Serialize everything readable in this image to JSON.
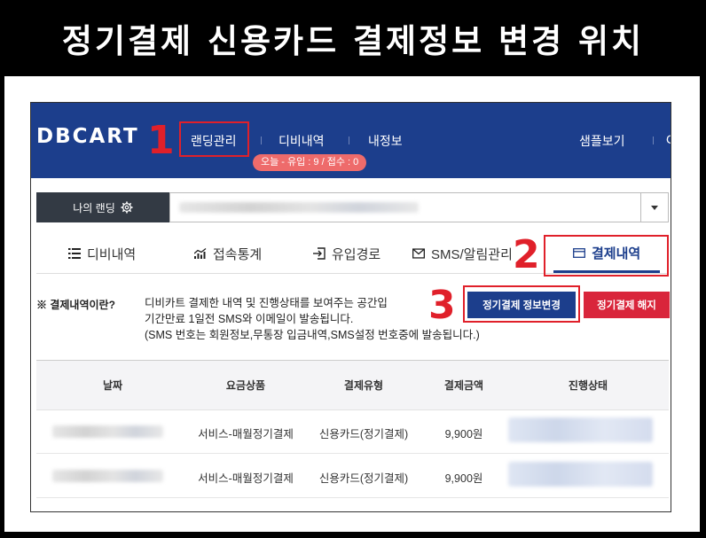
{
  "banner": {
    "title": "정기결제 신용카드 결제정보 변경 위치"
  },
  "navbar": {
    "logo": "DBCART",
    "items": [
      "랜딩관리",
      "디비내역",
      "내정보"
    ],
    "right_items": [
      "샘플보기",
      "C"
    ],
    "badge": "오늘 - 유입 : 9 / 접수 : 0"
  },
  "landing": {
    "label": "나의 랜딩",
    "settings_icon": "gear-icon",
    "selected_value": ""
  },
  "tabs": [
    {
      "label": "디비내역",
      "icon": "list-icon"
    },
    {
      "label": "접속통계",
      "icon": "chart-icon"
    },
    {
      "label": "유입경로",
      "icon": "signin-icon"
    },
    {
      "label": "SMS/알림관리",
      "icon": "mail-icon"
    },
    {
      "label": "결제내역",
      "icon": "card-icon",
      "active": true
    }
  ],
  "info": {
    "title": "※ 결제내역이란?",
    "lines": [
      "디비카트 결제한 내역 및 진행상태를 보여주는 공간입",
      "기간만료 1일전 SMS와 이메일이 발송됩니다.",
      "(SMS 번호는 회원정보,무통장 입금내역,SMS설정 번호중에 발송됩니다.)"
    ]
  },
  "buttons": {
    "change": "정기결제 정보변경",
    "cancel": "정기결제 해지"
  },
  "table": {
    "headers": [
      "날짜",
      "요금상품",
      "결제유형",
      "결제금액",
      "진행상태"
    ],
    "rows": [
      {
        "date": "",
        "product": "서비스-매월정기결제",
        "type": "신용카드(정기결제)",
        "amount": "9,900원",
        "status": ""
      },
      {
        "date": "",
        "product": "서비스-매월정기결제",
        "type": "신용카드(정기결제)",
        "amount": "9,900원",
        "status": ""
      }
    ]
  },
  "annotations": {
    "n1": "1",
    "n2": "2",
    "n3": "3"
  },
  "colors": {
    "navy": "#1c3e8c",
    "red": "#d9253b",
    "annotation": "#e0202a",
    "badge": "#ee6b6b"
  }
}
